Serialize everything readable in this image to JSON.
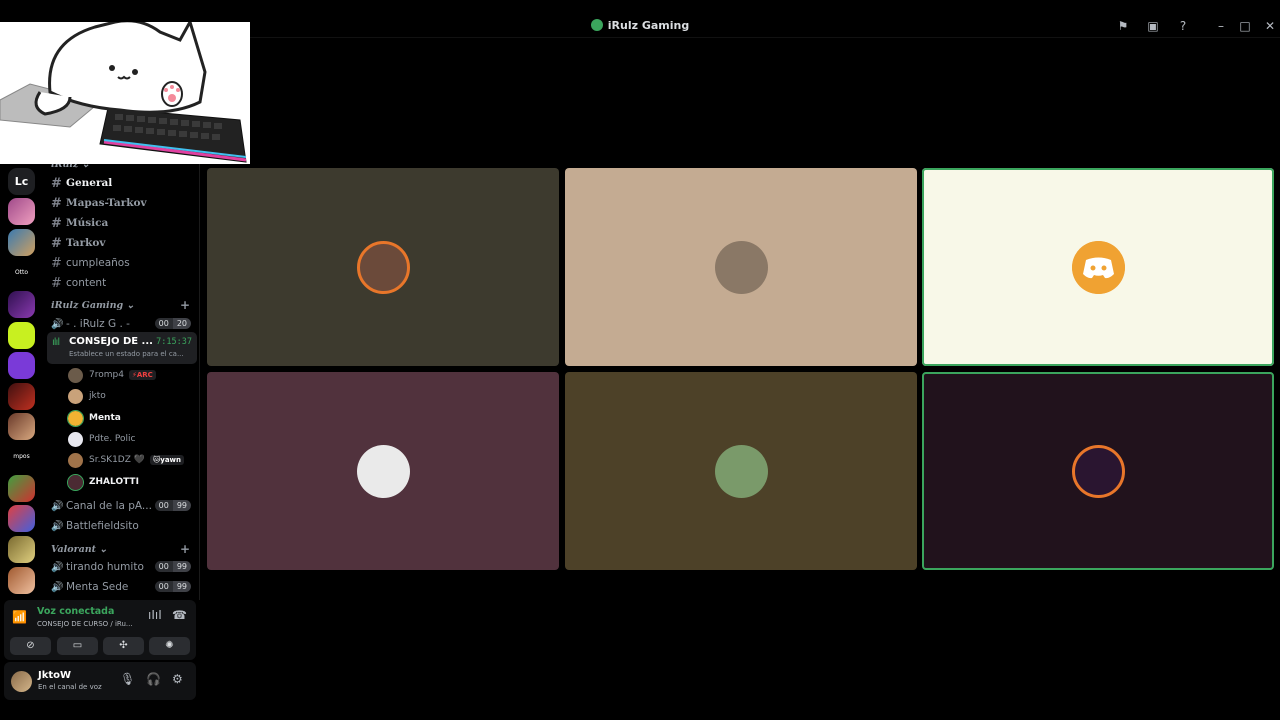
{
  "window": {
    "title": "iRulz Gaming"
  },
  "server": {
    "name": "iRulz",
    "rail_items": [
      "Lc",
      "Otto",
      "mpos"
    ]
  },
  "categories": {
    "first": "iRulz",
    "gaming": "iRulz Gaming",
    "valorant": "Valorant"
  },
  "text_channels": [
    "General",
    "Mapas-Tarkov",
    "Música",
    "Tarkov",
    "cumpleaños",
    "content"
  ],
  "voice_channels": {
    "ch1": {
      "name": "- . iRulz G . -",
      "a": "00",
      "b": "20"
    },
    "active": {
      "name": "CONSEJO DE ...",
      "timer": "7:15:37",
      "status": "Establece un estado para el ca..."
    },
    "ch3": {
      "name": "Canal de la pA...",
      "a": "00",
      "b": "99"
    },
    "ch4": {
      "name": "Battlefieldsito"
    },
    "ch5": {
      "name": "tirando humito",
      "a": "00",
      "b": "99"
    },
    "ch6": {
      "name": "Menta Sede",
      "a": "00",
      "b": "99"
    }
  },
  "voice_users": [
    {
      "name": "7romp4",
      "tag": "⚡ARC",
      "color": "#6b5b4a"
    },
    {
      "name": "jkto",
      "tag": "",
      "color": "#c9a27a"
    },
    {
      "name": "Menta",
      "tag": "",
      "color": "#f0b232"
    },
    {
      "name": "Pdte. Polic",
      "tag": "",
      "color": "#e8e8f0"
    },
    {
      "name": "Sr.SK1DZ 🖤",
      "tag": "🐱yawn",
      "color": "#a0734a"
    },
    {
      "name": "ZHALOTTI",
      "tag": "",
      "color": "#4b2a33"
    }
  ],
  "voice_panel": {
    "title": "Voz conectada",
    "sub": "CONSEJO DE CURSO / iRu..."
  },
  "user_panel": {
    "name": "JktoW",
    "status": "En el canal de voz"
  },
  "tiles": [
    {
      "bg": "#3d3a2e",
      "avatar": "#6b4a3a",
      "speaking": false
    },
    {
      "bg": "#c4ab92",
      "avatar": "#8a7866",
      "speaking": false
    },
    {
      "bg": "#f8f8e8",
      "avatar": "#f0a232",
      "speaking": true
    },
    {
      "bg": "#51323d",
      "avatar": "#eaeaea",
      "speaking": false
    },
    {
      "bg": "#4d4128",
      "avatar": "#7a9a6a",
      "speaking": false
    },
    {
      "bg": "#21121c",
      "avatar": "#2a1530",
      "speaking": true
    }
  ],
  "colors": {
    "accent_green": "#3ba55d",
    "bg": "#000000"
  }
}
